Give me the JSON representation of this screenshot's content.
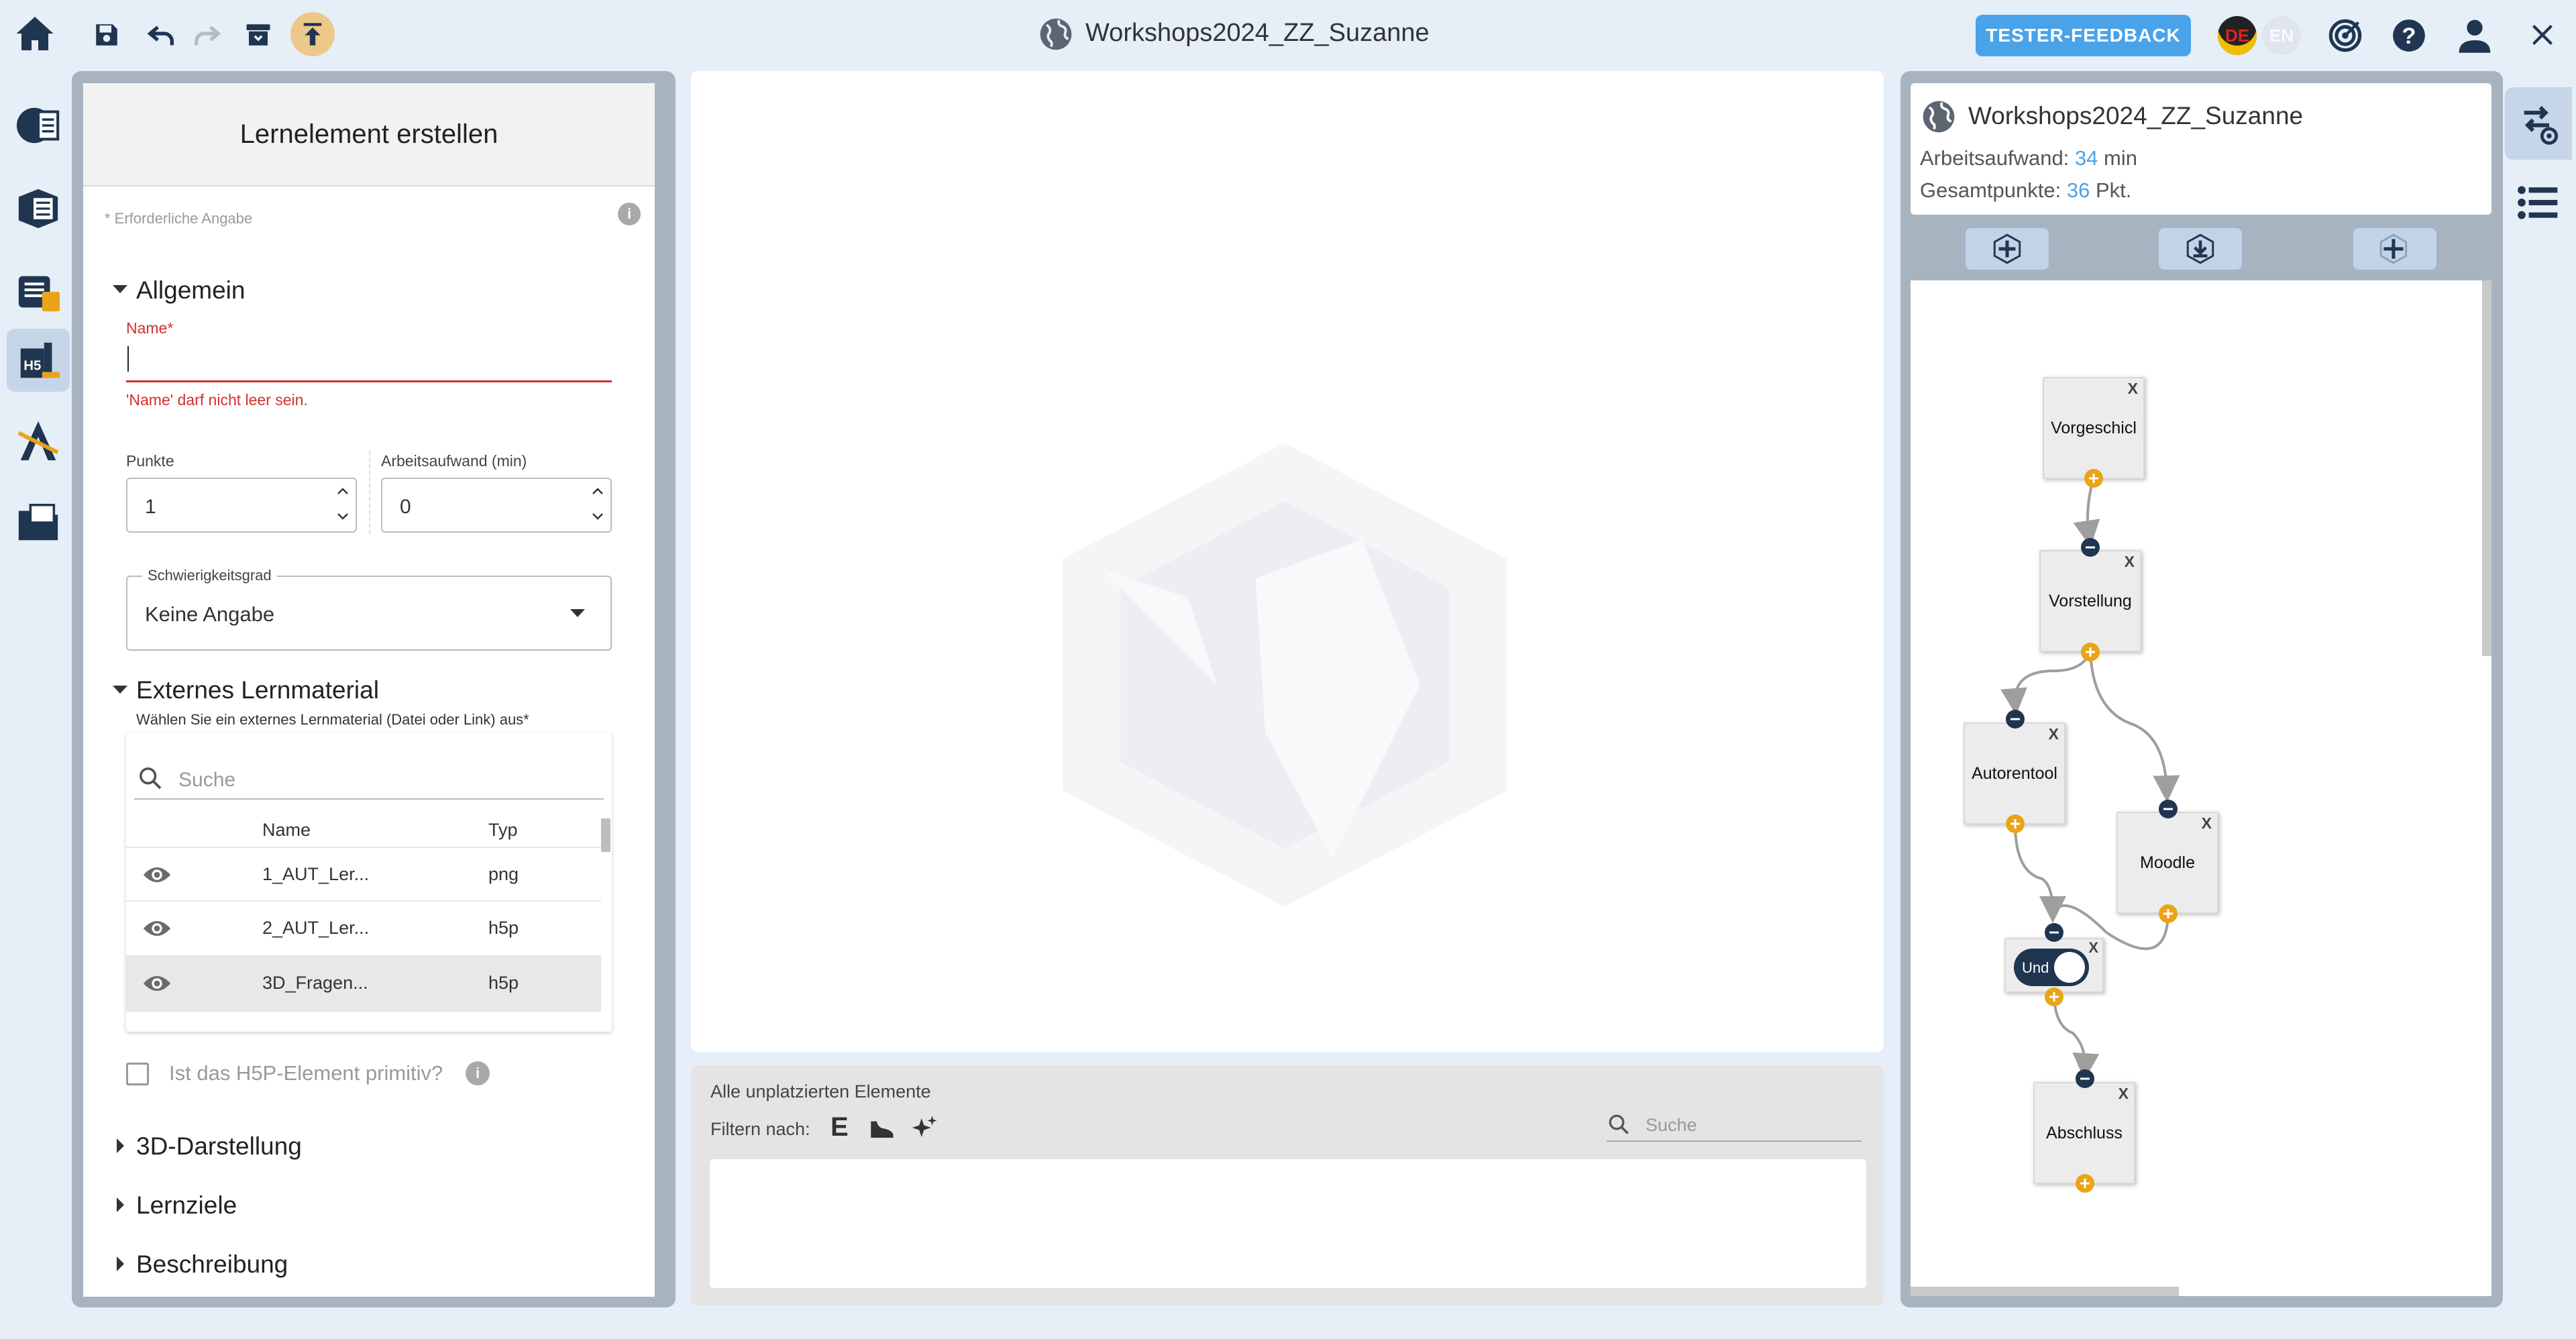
{
  "topbar": {
    "title": "Workshops2024_ZZ_Suzanne",
    "feedback_label": "TESTER-FEEDBACK",
    "lang_de": "DE",
    "lang_en": "EN"
  },
  "panel": {
    "title": "Lernelement erstellen",
    "required_note": "* Erforderliche Angabe",
    "section_general": "Allgemein",
    "name_label": "Name*",
    "name_value": "",
    "name_error": "'Name' darf nicht leer sein.",
    "points_label": "Punkte",
    "points_value": "1",
    "effort_label": "Arbeitsaufwand (min)",
    "effort_value": "0",
    "difficulty_label": "Schwierigkeitsgrad",
    "difficulty_value": "Keine Angabe",
    "section_material": "Externes Lernmaterial",
    "material_hint": "Wählen Sie ein externes Lernmaterial (Datei oder Link) aus*",
    "search_placeholder": "Suche",
    "col_name": "Name",
    "col_type": "Typ",
    "rows": [
      {
        "name": "1_AUT_Ler...",
        "type": "png"
      },
      {
        "name": "2_AUT_Ler...",
        "type": "h5p"
      },
      {
        "name": "3D_Fragen...",
        "type": "h5p"
      }
    ],
    "h5p_primitive_label": "Ist das H5P-Element primitiv?",
    "section_3d": "3D-Darstellung",
    "section_goals": "Lernziele",
    "section_desc": "Beschreibung"
  },
  "unplaced": {
    "title": "Alle unplatzierten Elemente",
    "filter_label": "Filtern nach:",
    "filter_e": "E",
    "search_placeholder": "Suche"
  },
  "world": {
    "name": "Workshops2024_ZZ_Suzanne",
    "effort_label": "Arbeitsaufwand:",
    "effort_value": "34",
    "effort_unit": "min",
    "points_label": "Gesamtpunkte:",
    "points_value": "36",
    "points_unit": "Pkt."
  },
  "graph": {
    "nodes": [
      {
        "label": "Vorgeschicl",
        "close": "X"
      },
      {
        "label": "Vorstellung",
        "close": "X"
      },
      {
        "label": "Autorentool",
        "close": "X"
      },
      {
        "label": "Moodle",
        "close": "X"
      },
      {
        "label": "Abschluss",
        "close": "X"
      }
    ],
    "and_label": "Und",
    "and_close": "X"
  },
  "colors": {
    "accent": "#4aa3e8",
    "error": "#d32f2f",
    "nav_active": "#c6d6e8",
    "port_plus": "#e9a417",
    "port_minus": "#1f3550"
  }
}
